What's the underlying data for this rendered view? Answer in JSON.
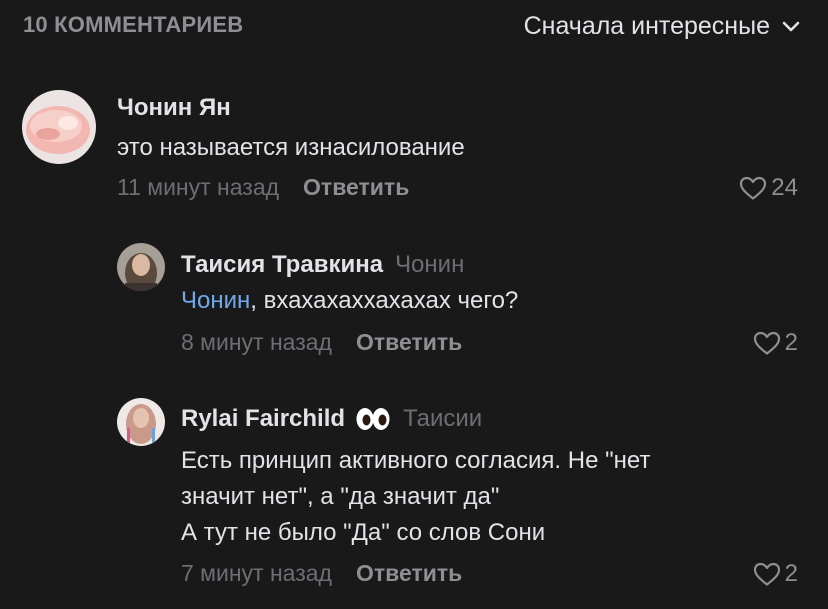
{
  "header": {
    "count_label": "10 КОММЕНТАРИЕВ",
    "sort_label": "Сначала интересные"
  },
  "comments": [
    {
      "author": "Чонин Ян",
      "text": "это называется изнасилование",
      "time": "11 минут назад",
      "reply_label": "Ответить",
      "likes": "24"
    },
    {
      "author": "Таисия Травкина",
      "reply_to": "Чонин",
      "mention": "Чонин",
      "text_rest": ", вхахахаххахахах чего?",
      "time": "8 минут назад",
      "reply_label": "Ответить",
      "likes": "2"
    },
    {
      "author": "Rylai Fairchild",
      "emoji": "eyes-emoji",
      "reply_to": "Таисии",
      "lines": [
        "Есть принцип активного согласия. Не \"нет",
        "значит нет\", а \"да значит да\"",
        "А тут не было \"Да\" со слов Сони"
      ],
      "time": "7 минут назад",
      "reply_label": "Ответить",
      "likes": "2"
    }
  ],
  "colors": {
    "background": "#19191a",
    "text": "#e1e3e6",
    "secondary": "#8e8f93",
    "muted": "#6d6e73",
    "link": "#71aaeb"
  }
}
